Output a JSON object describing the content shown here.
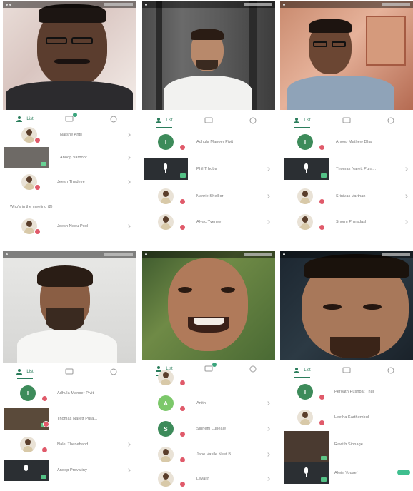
{
  "tabs": {
    "people_label": "List",
    "chat_label": "",
    "info_label": ""
  },
  "panels": [
    {
      "id": "p1",
      "rows": [
        {
          "name": "Narshe Antil"
        },
        {
          "name": "Anoop Vardoor"
        },
        {
          "name": "Jeesh Thedeve"
        },
        {
          "name": "Joesh Nedu Pool"
        }
      ],
      "note": "Who's in the meeting (2)"
    },
    {
      "id": "p2",
      "rows": [
        {
          "name": "Adhula Manoer Pivit",
          "initial": "I"
        },
        {
          "name": "Phil T hoba"
        },
        {
          "name": "Nanrie Shellior"
        },
        {
          "name": "Alvac Yvenee"
        }
      ]
    },
    {
      "id": "p3",
      "rows": [
        {
          "name": "Anoop Mathew Dhar",
          "initial": "I"
        },
        {
          "name": "Thomas Narett Pura..."
        },
        {
          "name": "Srinivas Varthan"
        },
        {
          "name": "Shorm Prmadash"
        }
      ]
    },
    {
      "id": "p4",
      "rows": [
        {
          "name": "Adhula Manoer Pivit",
          "initial": "I"
        },
        {
          "name": "Thomas Narett Pura..."
        },
        {
          "name": "Nalel Thenehand"
        },
        {
          "name": "Anoop Provatiny"
        }
      ]
    },
    {
      "id": "p5",
      "rows": [
        {
          "name": "",
          "initial": ""
        },
        {
          "name": "Anith",
          "initial": "A"
        },
        {
          "name": "Sinnem Luneale",
          "initial": "S"
        },
        {
          "name": "Jane Vasile Neet B"
        },
        {
          "name": "Levalth T"
        }
      ]
    },
    {
      "id": "p6",
      "rows": [
        {
          "name": "Peroath Pushpat Thuji",
          "initial": "I"
        },
        {
          "name": "Leetha Karthembull"
        },
        {
          "name": "Rawith Sinnage"
        },
        {
          "name": "Alwin Yousef"
        }
      ]
    }
  ],
  "colors": {
    "accent": "#2a7d5b",
    "badge": "#e05a6a",
    "green_avatar": "#3d8b5a"
  },
  "icons": [
    "people-icon",
    "chat-icon",
    "info-icon",
    "mic-icon",
    "camera-icon"
  ]
}
